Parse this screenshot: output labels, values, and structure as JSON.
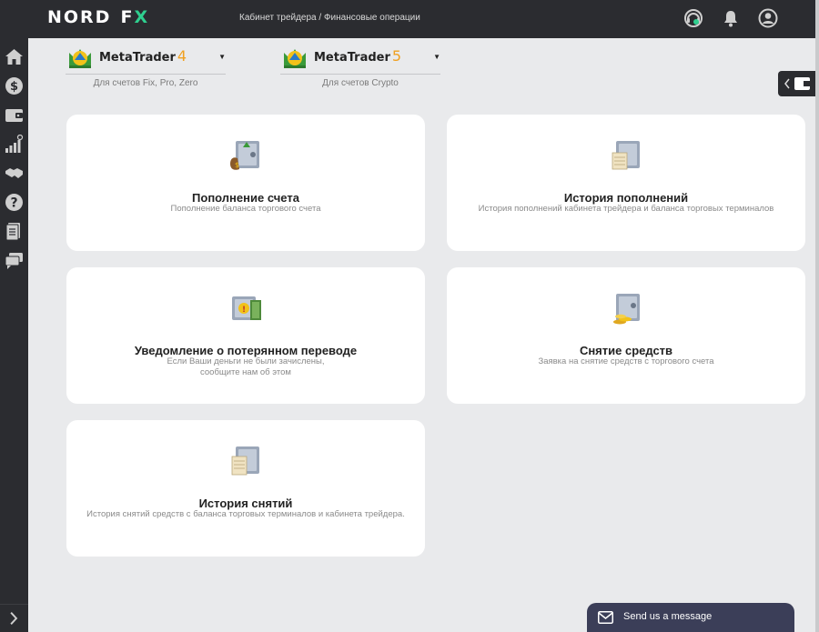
{
  "header": {
    "logo_left": "NORD",
    "logo_right_f": "F",
    "logo_right_x": "X",
    "breadcrumb": "Кабинет трейдера / Финансовые операции",
    "icons": [
      "support-icon",
      "bell-icon",
      "user-icon"
    ]
  },
  "sidebar": {
    "icons": [
      "home-icon",
      "dollar-icon",
      "wallet-icon",
      "chart-icon",
      "handshake-icon",
      "help-icon",
      "document-icon",
      "chat-icon"
    ],
    "toggle_icon": "chevron-right-icon"
  },
  "platforms": [
    {
      "name": "MetaTrader",
      "version": "4",
      "subtitle": "Для счетов Fix, Pro, Zero"
    },
    {
      "name": "MetaTrader",
      "version": "5",
      "subtitle": "Для счетов Crypto"
    }
  ],
  "cards": [
    {
      "title": "Пополнение счета",
      "desc": [
        "Пополнение баланса торгового счета"
      ]
    },
    {
      "title": "История пополнений",
      "desc": [
        "История пополнений кабинета трейдера и баланса торговых терминалов"
      ]
    },
    {
      "title": "Уведомление о потерянном переводе",
      "desc": [
        "Если Ваши деньги не были зачислены,",
        "сообщите нам об этом"
      ]
    },
    {
      "title": "Снятие средств",
      "desc": [
        "Заявка на снятие средств с торгового счета"
      ]
    },
    {
      "title": "История снятий",
      "desc": [
        "История снятий средств с баланса торговых терминалов и кабинета трейдера."
      ]
    }
  ],
  "chat": {
    "label": "Send us a message"
  },
  "colors": {
    "dark": "#2b2c30",
    "accent_green": "#2fcf8f",
    "mt_orange": "#f0a020",
    "chat_bg": "#3b3e58"
  }
}
